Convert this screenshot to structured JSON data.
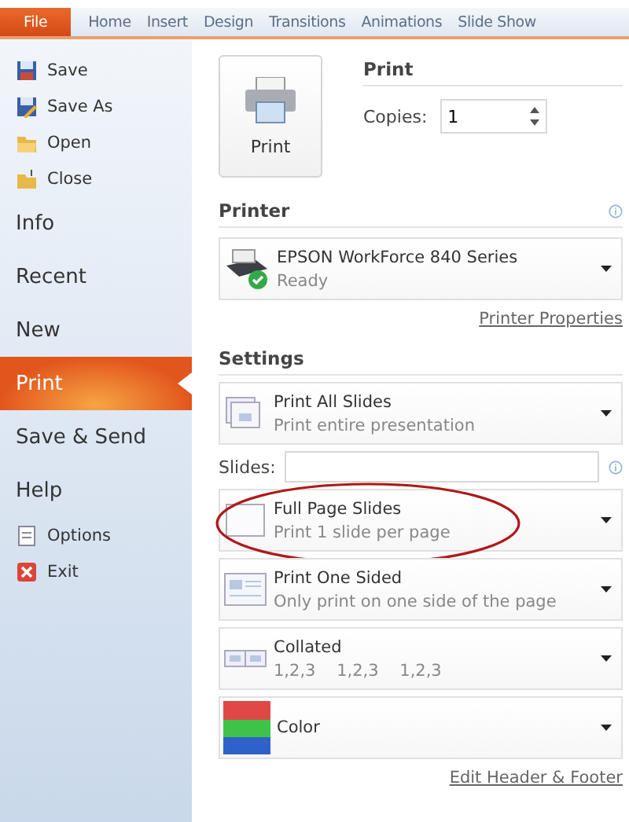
{
  "tabs": [
    {
      "label": "File",
      "selected": true
    },
    {
      "label": "Home",
      "selected": false
    },
    {
      "label": "Insert",
      "selected": false
    },
    {
      "label": "Design",
      "selected": false
    },
    {
      "label": "Transitions",
      "selected": false
    },
    {
      "label": "Animations",
      "selected": false
    },
    {
      "label": "Slide Show",
      "selected": false
    }
  ],
  "sidebar": {
    "items": [
      {
        "label": "Save",
        "kind": "small",
        "selected": false
      },
      {
        "label": "Save As",
        "kind": "small",
        "selected": false
      },
      {
        "label": "Open",
        "kind": "small",
        "selected": false
      },
      {
        "label": "Close",
        "kind": "small",
        "selected": false
      },
      {
        "label": "Info",
        "kind": "large",
        "selected": false
      },
      {
        "label": "Recent",
        "kind": "large",
        "selected": false
      },
      {
        "label": "New",
        "kind": "large",
        "selected": false
      },
      {
        "label": "Print",
        "kind": "large",
        "selected": true
      },
      {
        "label": "Save & Send",
        "kind": "large",
        "selected": false
      },
      {
        "label": "Help",
        "kind": "large",
        "selected": false
      },
      {
        "label": "Options",
        "kind": "small",
        "selected": false
      },
      {
        "label": "Exit",
        "kind": "small",
        "selected": false
      }
    ]
  },
  "print": {
    "button": "Print",
    "heading": "Print",
    "copies_label": "Copies:",
    "copies_value": "1"
  },
  "printer": {
    "heading": "Printer",
    "name": "EPSON WorkForce 840 Series",
    "status": "Ready",
    "properties_link": "Printer Properties"
  },
  "settings": {
    "heading": "Settings",
    "slides_label": "Slides:",
    "options": [
      {
        "kind": "slides",
        "title": "Print All Slides",
        "subtitle": "Print entire presentation",
        "circled": false
      },
      {
        "kind": "layout",
        "title": "Full Page Slides",
        "subtitle": "Print 1 slide per page",
        "circled": true
      },
      {
        "kind": "sides",
        "title": "Print One Sided",
        "subtitle": "Only print on one side of the page",
        "circled": false
      },
      {
        "kind": "collate",
        "title": "Collated",
        "subtitle": "1,2,3    1,2,3    1,2,3",
        "circled": false
      },
      {
        "kind": "color",
        "title": "Color",
        "circled": false
      }
    ],
    "footer_link": "Edit Header & Footer"
  }
}
